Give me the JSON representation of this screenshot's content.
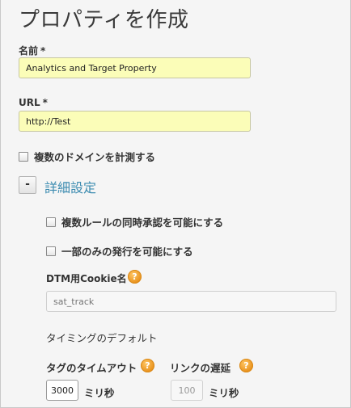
{
  "page": {
    "title": "プロパティを作成"
  },
  "name_field": {
    "label": "名前",
    "required_mark": "*",
    "value": "Analytics and Target Property"
  },
  "url_field": {
    "label": "URL",
    "required_mark": "*",
    "value": "http://Test"
  },
  "multi_domain": {
    "label": "複数のドメインを計測する",
    "checked": false
  },
  "advanced": {
    "toggle_symbol": "-",
    "title": "詳細設定",
    "concurrent_rules": {
      "label": "複数ルールの同時承認を可能にする",
      "checked": false
    },
    "partial_publish": {
      "label": "一部のみの発行を可能にする",
      "checked": false
    },
    "cookie_name": {
      "label": "DTM用Cookie名",
      "help": "?",
      "placeholder": "sat_track"
    },
    "timing_defaults": {
      "label": "タイミングのデフォルト"
    },
    "tag_timeout": {
      "label": "タグのタイムアウト",
      "help": "?",
      "value": "3000",
      "unit": "ミリ秒"
    },
    "link_delay": {
      "label": "リンクの遅延",
      "help": "?",
      "value": "100",
      "unit": "ミリ秒"
    }
  },
  "colors": {
    "accent": "#3b8bb0",
    "input_highlight": "#fbfdb8",
    "help_icon": "#e8901a"
  }
}
